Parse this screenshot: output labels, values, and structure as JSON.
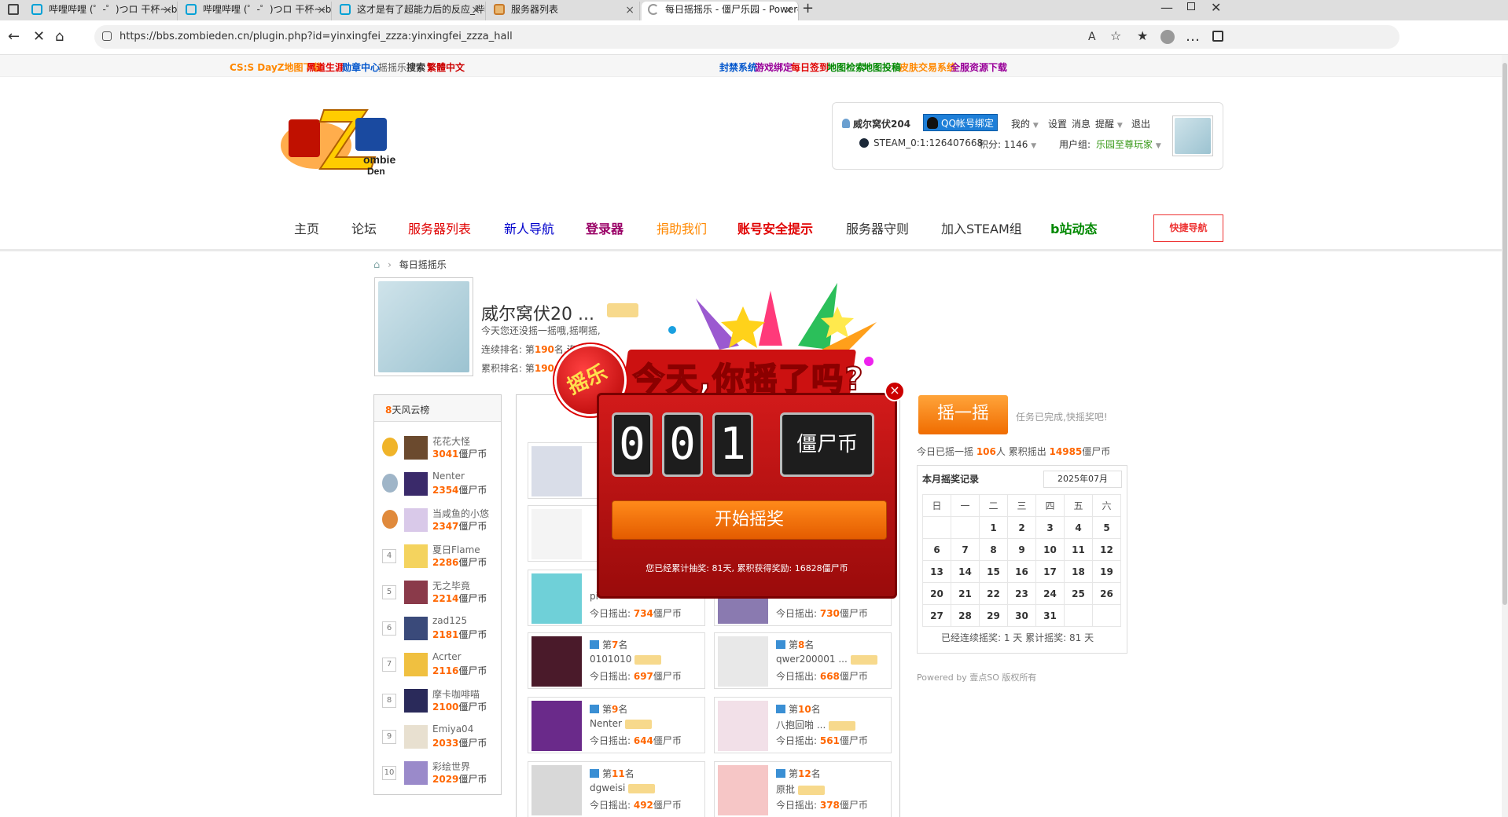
{
  "browser": {
    "tabs": [
      {
        "title": "哔哩哔哩 (゜-゜)つロ 干杯~-bilib",
        "icon": "bilibili-icon"
      },
      {
        "title": "哔哩哔哩 (゜-゜)つロ 干杯~-bilib",
        "icon": "bilibili-icon"
      },
      {
        "title": "这才是有了超能力后的反应_哔哩",
        "icon": "bilibili-icon"
      },
      {
        "title": "服务器列表",
        "icon": "server-icon"
      },
      {
        "title": "每日摇摇乐 - 僵尸乐园 - Powered",
        "icon": "loading-icon"
      }
    ],
    "url": "https://bbs.zombieden.cn/plugin.php?id=yinxingfei_zzza:yinxingfei_zzza_hall"
  },
  "toplinks": {
    "left": [
      {
        "label": "CS:S DayZ地图下载",
        "color": "#ff8800"
      },
      {
        "label": "黑道生涯",
        "color": "#e00000"
      },
      {
        "label": "勋章中心",
        "color": "#0055cc"
      },
      {
        "label": "摇摇乐",
        "color": "#555555"
      },
      {
        "label": "搜索",
        "color": "#333333"
      },
      {
        "label": "繁體中文",
        "color": "#cc0000"
      }
    ],
    "right": [
      {
        "label": "封禁系统",
        "color": "#0055cc"
      },
      {
        "label": "游戏绑定",
        "color": "#990099"
      },
      {
        "label": "每日签到",
        "color": "#e00000"
      },
      {
        "label": "地图检索",
        "color": "#008800"
      },
      {
        "label": "地图投稿",
        "color": "#008800"
      },
      {
        "label": "皮肤交易系统",
        "color": "#ff8800"
      },
      {
        "label": "全服资源下载",
        "color": "#990099"
      }
    ]
  },
  "user": {
    "name": "威尔窝伏204",
    "qq_bind": "QQ帐号绑定",
    "menu": [
      "我的",
      "设置",
      "消息",
      "提醒",
      "退出"
    ],
    "steam": "STEAM_0:1:126407668",
    "points": "积分: 1146",
    "group_label": "用户组:",
    "group": "乐园至尊玩家"
  },
  "nav": [
    {
      "label": "主页",
      "color": "#333333",
      "bold": false
    },
    {
      "label": "论坛",
      "color": "#333333",
      "bold": false
    },
    {
      "label": "服务器列表",
      "color": "#e00000",
      "bold": false
    },
    {
      "label": "新人导航",
      "color": "#0000cc",
      "bold": false
    },
    {
      "label": "登录器",
      "color": "#990066",
      "bold": true
    },
    {
      "label": "捐助我们",
      "color": "#ff8800",
      "bold": false
    },
    {
      "label": "账号安全提示",
      "color": "#e00000",
      "bold": true
    },
    {
      "label": "服务器守则",
      "color": "#333333",
      "bold": false
    },
    {
      "label": "加入STEAM组",
      "color": "#333333",
      "bold": false
    },
    {
      "label": "b站动态",
      "color": "#008800",
      "bold": true
    }
  ],
  "quick_nav": "快捷导航",
  "breadcrumb": "每日摇摇乐",
  "profile": {
    "name": "威尔窝伏20 ...",
    "status": "今天您还没摇一摇哦,摇啊摇,",
    "streak_prefix": "连续排名: 第",
    "streak_rank": "190",
    "streak_suffix": "名,连",
    "total_prefix": "累积排名: 第",
    "total_rank": "1906"
  },
  "leaderboard": {
    "title_num": "8",
    "title": "天风云榜",
    "unit": "僵尸币",
    "items": [
      {
        "rank": "1",
        "name": "花花大怪",
        "score": "3041"
      },
      {
        "rank": "2",
        "name": "Nenter",
        "score": "2354"
      },
      {
        "rank": "3",
        "name": "当咸鱼的小悠",
        "score": "2347"
      },
      {
        "rank": "4",
        "name": "夏日Flame",
        "score": "2286"
      },
      {
        "rank": "5",
        "name": "无之毕竟",
        "score": "2214"
      },
      {
        "rank": "6",
        "name": "zad125",
        "score": "2181"
      },
      {
        "rank": "7",
        "name": "Acrter",
        "score": "2116"
      },
      {
        "rank": "8",
        "name": "摩卡咖啡喵",
        "score": "2100"
      },
      {
        "rank": "9",
        "name": "Emiya04",
        "score": "2033"
      },
      {
        "rank": "10",
        "name": "彩绘世界",
        "score": "2029"
      }
    ]
  },
  "today_cards": {
    "rank_prefix": "第",
    "rank_suffix": "名",
    "score_prefix": "今日摇出: ",
    "unit": "僵尸币",
    "items": [
      {
        "rank": "7",
        "name": "0101010",
        "score": "697"
      },
      {
        "rank": "8",
        "name": "qwer200001 ...",
        "score": "668"
      },
      {
        "rank": "9",
        "name": "Nenter",
        "score": "644"
      },
      {
        "rank": "10",
        "name": "八抱回啪 ...",
        "score": "561"
      },
      {
        "rank": "11",
        "name": "dgweisi",
        "score": "492"
      },
      {
        "rank": "12",
        "name": "原批",
        "score": "378"
      }
    ],
    "partial": [
      {
        "name": "pi",
        "score": "734"
      },
      {
        "score": "730"
      }
    ]
  },
  "shake": {
    "button": "摇一摇",
    "done": "任务已完成,快摇奖吧!",
    "today_prefix": "今日已摇一摇 ",
    "today_count": "106",
    "today_mid": "人 累积摇出 ",
    "total_coins": "14985",
    "unit": "僵尸币"
  },
  "calendar": {
    "title": "本月摇奖记录",
    "month": "2025年07月",
    "weekdays": [
      "日",
      "一",
      "二",
      "三",
      "四",
      "五",
      "六"
    ],
    "days": [
      "",
      "",
      "1",
      "2",
      "3",
      "4",
      "5",
      "6",
      "7",
      "8",
      "9",
      "10",
      "11",
      "12",
      "13",
      "14",
      "15",
      "16",
      "17",
      "18",
      "19",
      "20",
      "21",
      "22",
      "23",
      "24",
      "25",
      "26",
      "27",
      "28",
      "29",
      "30",
      "31",
      "",
      ""
    ],
    "footer": "已经连续摇奖: 1 天 累计摇奖: 81 天"
  },
  "powered": "Powered by 壹点SO 版权所有",
  "popup": {
    "badge": "摇乐",
    "title": "今天,你摇了吗?",
    "digits": [
      "0",
      "0",
      "1"
    ],
    "unit": "僵尸币",
    "start": "开始摇奖",
    "total": "您已经累计抽奖: 81天, 累积获得奖励: 16828僵尸币"
  }
}
